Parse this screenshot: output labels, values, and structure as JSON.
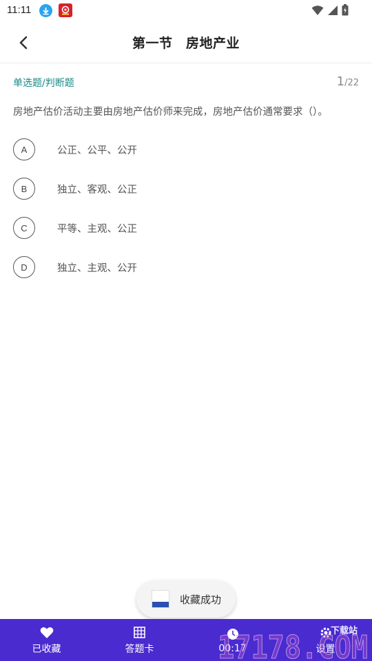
{
  "status_bar": {
    "time": "11:11",
    "icons": [
      "download-icon",
      "app-badge-icon",
      "wifi-icon",
      "signal-icon",
      "battery-icon"
    ]
  },
  "header": {
    "title": "第一节　房地产业",
    "back_icon": "chevron-left-icon"
  },
  "question": {
    "type_label": "单选题/判断题",
    "current": "1",
    "total": "/22",
    "text": "房地产估价活动主要由房地产估价师来完成，房地产估价通常要求（）。",
    "options": [
      {
        "letter": "A",
        "text": "公正、公平、公开"
      },
      {
        "letter": "B",
        "text": "独立、客观、公正"
      },
      {
        "letter": "C",
        "text": "平等、主观、公正"
      },
      {
        "letter": "D",
        "text": "独立、主观、公开"
      }
    ]
  },
  "toast": {
    "text": "收藏成功"
  },
  "bottom_bar": {
    "tabs": [
      {
        "label": "已收藏",
        "icon": "heart-icon"
      },
      {
        "label": "答题卡",
        "icon": "grid-card-icon"
      },
      {
        "label": "00:17",
        "icon": "clock-icon"
      },
      {
        "label": "设置",
        "icon": "settings-icon"
      }
    ]
  },
  "watermark": {
    "text": "17178.COM",
    "sub": "下载站"
  },
  "colors": {
    "accent": "#4a2bd0",
    "type_label": "#1a8a8a",
    "text": "#555555"
  }
}
